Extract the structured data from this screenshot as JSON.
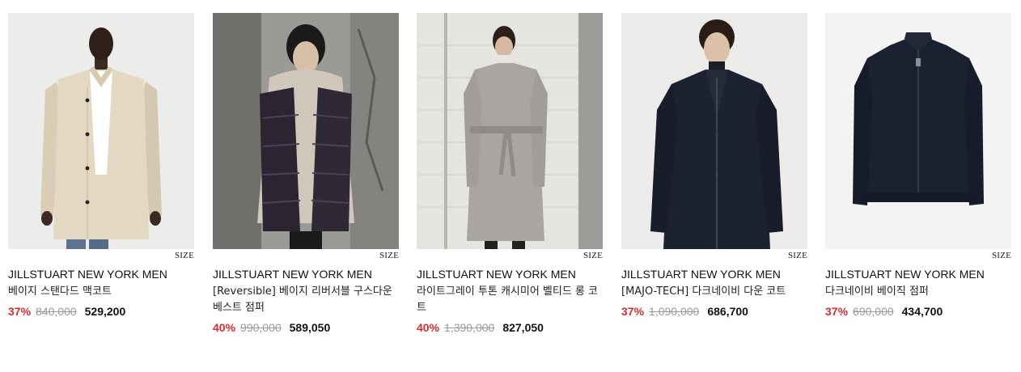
{
  "size_label": "SIZE",
  "products": [
    {
      "brand": "JILLSTUART NEW YORK MEN",
      "name": "베이지 스탠다드 맥코트",
      "discount": "37%",
      "original_price": "840,000",
      "price": "529,200",
      "image": "beige-mac-coat-photo"
    },
    {
      "brand": "JILLSTUART NEW YORK MEN",
      "name": "[Reversible] 베이지 리버서블 구스다운 베스트 점퍼",
      "discount": "40%",
      "original_price": "990,000",
      "price": "589,050",
      "image": "reversible-down-vest-photo"
    },
    {
      "brand": "JILLSTUART NEW YORK MEN",
      "name": "라이트그레이 투톤 캐시미어 벨티드 롱 코트",
      "discount": "40%",
      "original_price": "1,390,000",
      "price": "827,050",
      "image": "grey-belted-coat-photo"
    },
    {
      "brand": "JILLSTUART NEW YORK MEN",
      "name": "[MAJO-TECH] 다크네이비 다운 코트",
      "discount": "37%",
      "original_price": "1,090,000",
      "price": "686,700",
      "image": "navy-down-coat-photo"
    },
    {
      "brand": "JILLSTUART NEW YORK MEN",
      "name": "다크네이비 베이직 점퍼",
      "discount": "37%",
      "original_price": "690,000",
      "price": "434,700",
      "image": "navy-jumper-photo"
    }
  ]
}
